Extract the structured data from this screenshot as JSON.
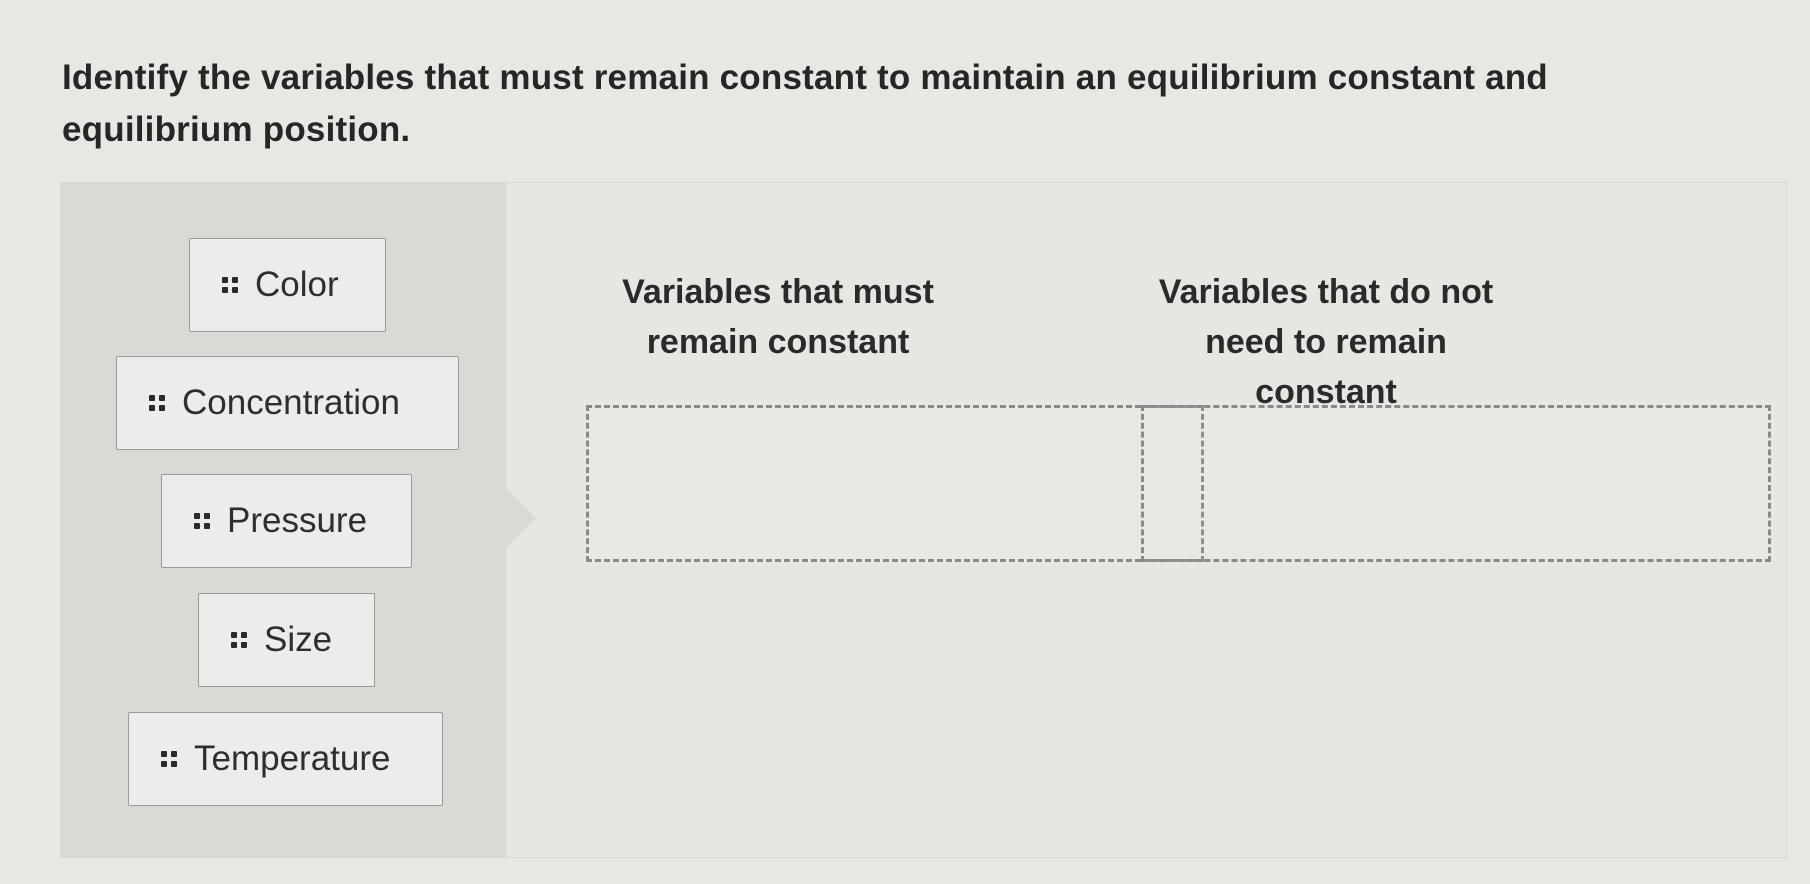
{
  "question": {
    "text": "Identify the variables that must remain constant to maintain an equilibrium constant and equilibrium position."
  },
  "source_items": [
    {
      "label": "Color",
      "icon": "drag-handle-icon"
    },
    {
      "label": "Concentration",
      "icon": "drag-handle-icon"
    },
    {
      "label": "Pressure",
      "icon": "drag-handle-icon"
    },
    {
      "label": "Size",
      "icon": "drag-handle-icon"
    },
    {
      "label": "Temperature",
      "icon": "drag-handle-icon"
    }
  ],
  "categories": [
    {
      "title": "Variables that must remain constant"
    },
    {
      "title": "Variables that do not need to remain constant"
    }
  ],
  "colors": {
    "background": "#e7e7e3",
    "source_panel": "#d9d9d6",
    "chip_border": "#9a9a98",
    "dropzone_border": "#8a8a88"
  }
}
